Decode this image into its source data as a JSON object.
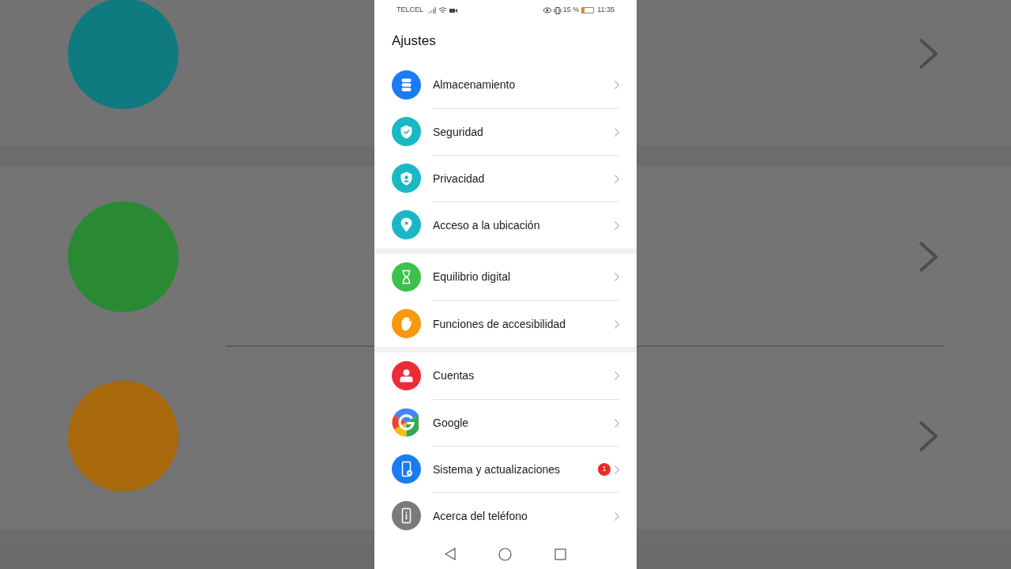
{
  "status_bar": {
    "carrier": "TELCEL",
    "battery_text": "15 %",
    "time": "11:35"
  },
  "title": "Ajustes",
  "groups": [
    {
      "items": [
        {
          "label": "Almacenamiento",
          "kind": "storage",
          "color": "#1a7cf0"
        },
        {
          "label": "Seguridad",
          "kind": "shield-check",
          "color": "#19b8c4"
        },
        {
          "label": "Privacidad",
          "kind": "shield-person",
          "color": "#19b8c4"
        },
        {
          "label": "Acceso a la ubicación",
          "kind": "pin",
          "color": "#19b8c4"
        }
      ]
    },
    {
      "items": [
        {
          "label": "Equilibrio digital",
          "kind": "hourglass",
          "color": "#3ec14c"
        },
        {
          "label": "Funciones de accesibilidad",
          "kind": "hand",
          "color": "#f7980f"
        }
      ]
    },
    {
      "items": [
        {
          "label": "Cuentas",
          "kind": "person",
          "color": "#ee2b34"
        },
        {
          "label": "Google",
          "kind": "google"
        },
        {
          "label": "Sistema y actualizaciones",
          "kind": "phone-gear",
          "color": "#1a7cf0",
          "badge": "1"
        },
        {
          "label": "Acerca del teléfono",
          "kind": "phone-info",
          "color": "#7a7a7a"
        }
      ]
    }
  ]
}
